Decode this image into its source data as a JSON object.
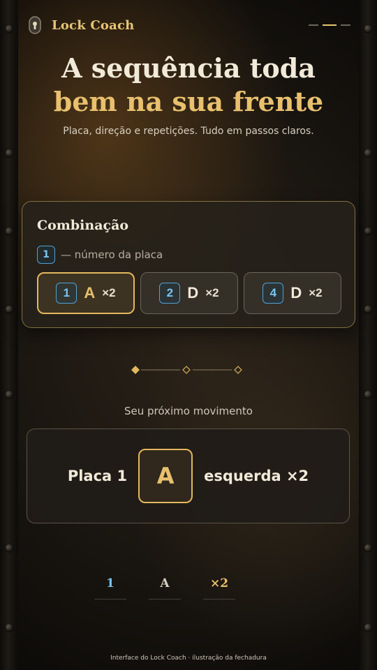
{
  "app": {
    "name": "Lock Coach",
    "icon": "lock-keyhole-icon"
  },
  "progress": {
    "steps": 3,
    "active_step": 2
  },
  "hero": {
    "line1": "A sequência toda",
    "line2": "bem na sua frente",
    "subtitle": "Placa, direção e repetições. Tudo em passos claros."
  },
  "combination": {
    "title": "Combinação",
    "legend_badge": "1",
    "legend_text": "— número da placa",
    "chips": [
      {
        "plate": "1",
        "letter": "A",
        "times": "×2",
        "selected": true
      },
      {
        "plate": "2",
        "letter": "D",
        "times": "×2",
        "selected": false
      },
      {
        "plate": "4",
        "letter": "D",
        "times": "×2",
        "selected": false
      }
    ]
  },
  "divider": {
    "icon": "diamond-steps-icon",
    "active_index": 0
  },
  "next_move": {
    "label": "Seu próximo movimento",
    "plate": "Placa 1",
    "letter": "A",
    "direction": "esquerda ×2"
  },
  "summary": {
    "plate": "1",
    "letter": "A",
    "times": "×2"
  },
  "footer": {
    "text": "Interface do Lock Coach · ilustração da fechadura"
  },
  "colors": {
    "accent": "#e8c06e",
    "plate_blue": "#4fa3d6",
    "text": "#f1ead9"
  }
}
